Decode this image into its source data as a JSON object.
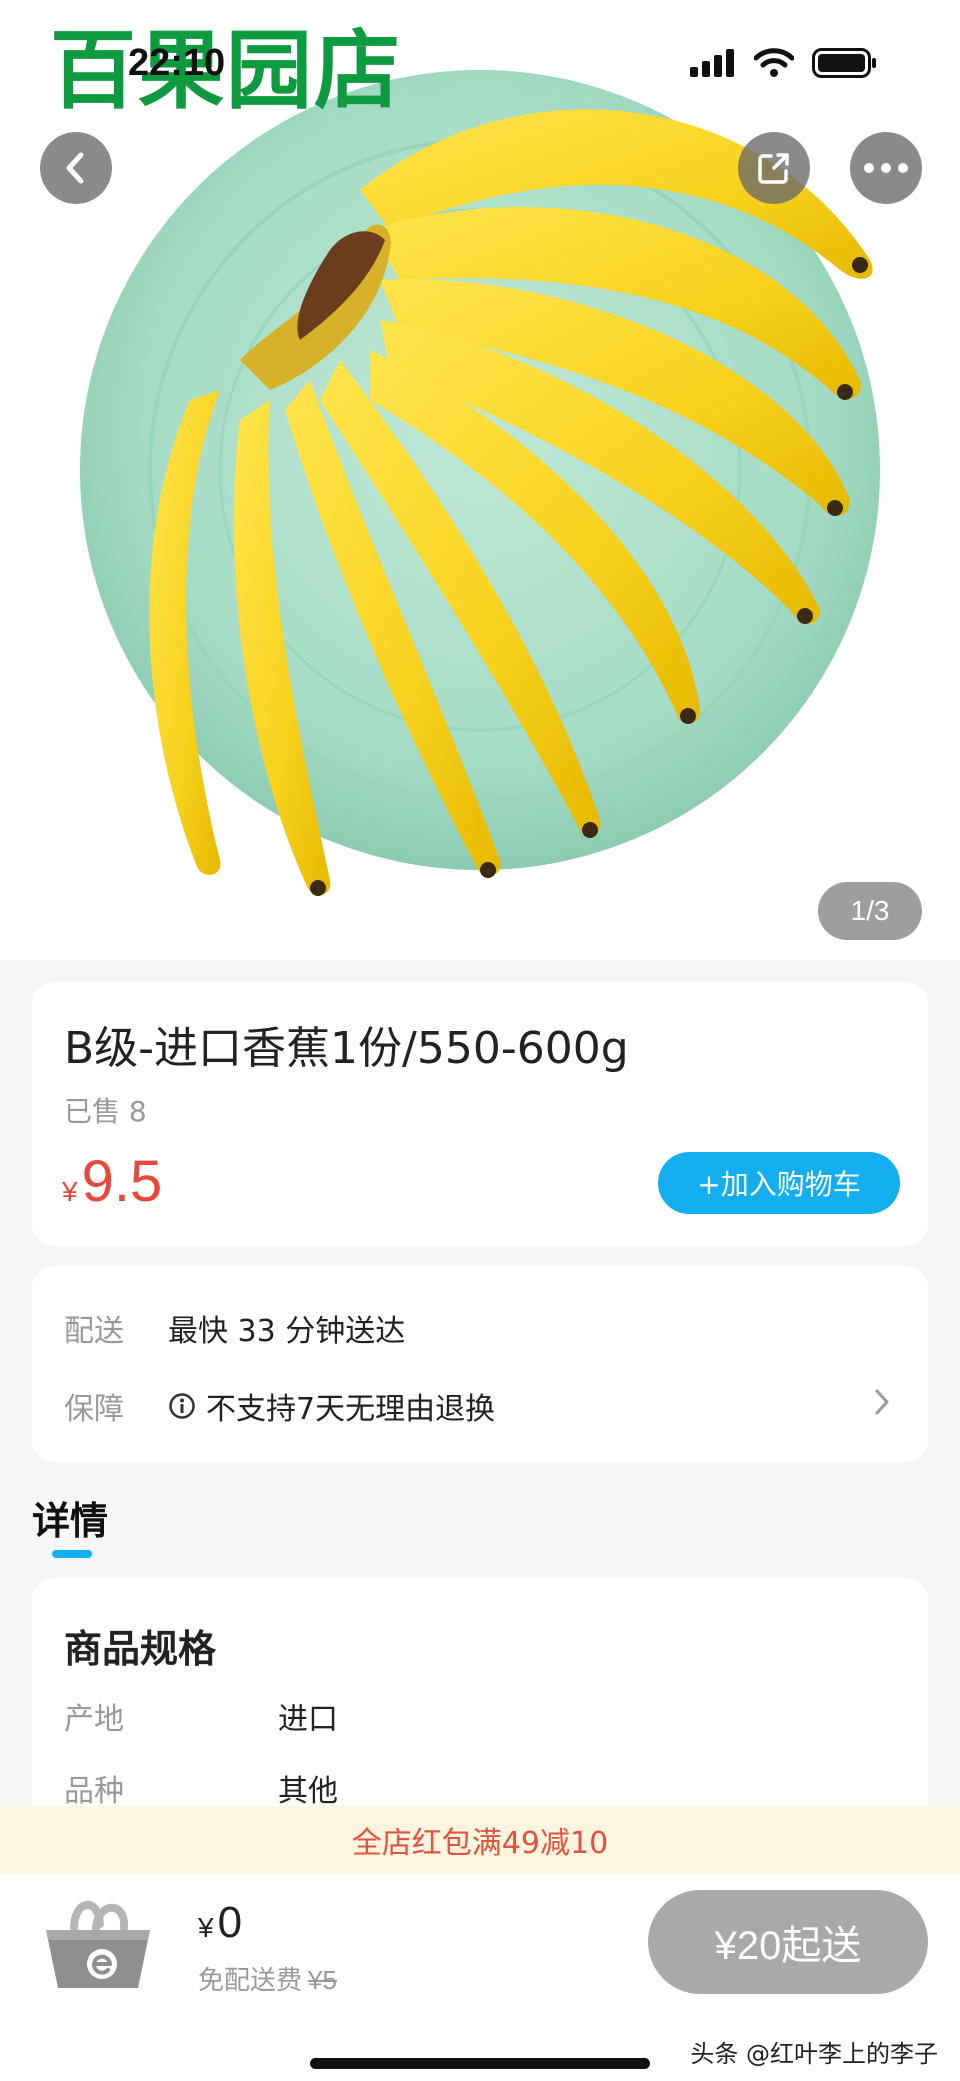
{
  "status_bar": {
    "time": "22:10"
  },
  "brand": {
    "logo_text": "百果园店"
  },
  "hero": {
    "pager": "1/3"
  },
  "product": {
    "title": "B级-进口香蕉1份/550-600g",
    "sold": "已售 8",
    "price_symbol": "¥",
    "price": "9.5",
    "add_to_cart": "+加入购物车"
  },
  "service": {
    "delivery_label": "配送",
    "delivery_value": "最快 33 分钟送达",
    "guarantee_label": "保障",
    "guarantee_value": "不支持7天无理由退换"
  },
  "details": {
    "tab": "详情"
  },
  "specs": {
    "title": "商品规格",
    "rows": [
      {
        "key": "产地",
        "value": "进口"
      },
      {
        "key": "品种",
        "value": "其他"
      }
    ]
  },
  "promo": {
    "text": "全店红包满49减10"
  },
  "bottom_bar": {
    "currency": "¥",
    "total": "0",
    "delivery_free": "免配送费",
    "delivery_original": "¥5",
    "min_order": "¥20起送"
  },
  "credit": "头条 @红叶李上的李子",
  "colors": {
    "accent": "#12aef0",
    "price": "#e8473a",
    "brand": "#0e9a3f",
    "promo_bg": "#fdf5df"
  },
  "icons": [
    "back-icon",
    "share-icon",
    "more-icon",
    "signal-icon",
    "wifi-icon",
    "battery-icon",
    "info-icon",
    "chevron-right-icon",
    "basket-icon"
  ]
}
